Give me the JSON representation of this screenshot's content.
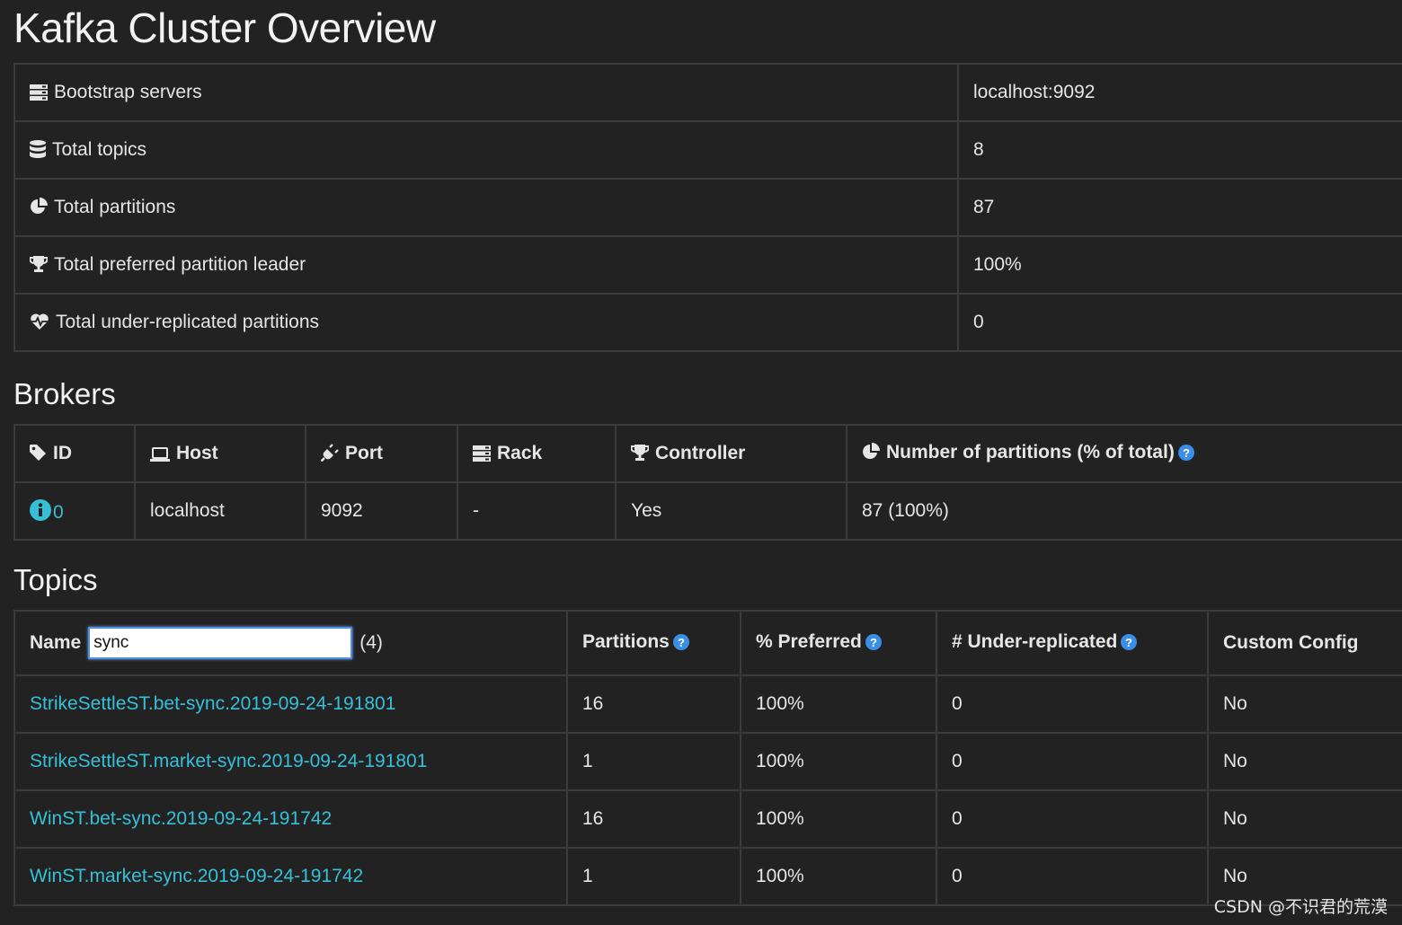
{
  "page": {
    "title": "Kafka Cluster Overview"
  },
  "overview": {
    "rows": [
      {
        "icon": "server-icon",
        "label": "Bootstrap servers",
        "value": "localhost:9092"
      },
      {
        "icon": "database-icon",
        "label": "Total topics",
        "value": "8"
      },
      {
        "icon": "pie-chart-icon",
        "label": "Total partitions",
        "value": "87"
      },
      {
        "icon": "trophy-icon",
        "label": "Total preferred partition leader",
        "value": "100%"
      },
      {
        "icon": "heartbeat-icon",
        "label": "Total under-replicated partitions",
        "value": "0"
      }
    ]
  },
  "brokers": {
    "heading": "Brokers",
    "columns": [
      {
        "icon": "tag-icon",
        "label": "ID"
      },
      {
        "icon": "laptop-icon",
        "label": "Host"
      },
      {
        "icon": "plug-icon",
        "label": "Port"
      },
      {
        "icon": "server-icon",
        "label": "Rack"
      },
      {
        "icon": "trophy-icon",
        "label": "Controller"
      },
      {
        "icon": "pie-chart-icon",
        "label": "Number of partitions (% of total)",
        "help": true
      }
    ],
    "rows": [
      {
        "id": "0",
        "host": "localhost",
        "port": "9092",
        "rack": "-",
        "controller": "Yes",
        "partitions": "87 (100%)"
      }
    ]
  },
  "topics": {
    "heading": "Topics",
    "filter": {
      "label": "Name",
      "value": "sync",
      "count": "(4)"
    },
    "columns": [
      {
        "label": "Partitions",
        "help": true
      },
      {
        "label": "% Preferred",
        "help": true
      },
      {
        "label": "# Under-replicated",
        "help": true
      },
      {
        "label": "Custom Config",
        "help": false
      }
    ],
    "rows": [
      {
        "name": "StrikeSettleST.bet-sync.2019-09-24-191801",
        "partitions": "16",
        "preferred": "100%",
        "under_replicated": "0",
        "custom_config": "No"
      },
      {
        "name": "StrikeSettleST.market-sync.2019-09-24-191801",
        "partitions": "1",
        "preferred": "100%",
        "under_replicated": "0",
        "custom_config": "No"
      },
      {
        "name": "WinST.bet-sync.2019-09-24-191742",
        "partitions": "16",
        "preferred": "100%",
        "under_replicated": "0",
        "custom_config": "No"
      },
      {
        "name": "WinST.market-sync.2019-09-24-191742",
        "partitions": "1",
        "preferred": "100%",
        "under_replicated": "0",
        "custom_config": "No"
      }
    ]
  },
  "watermark": "CSDN @不识君的荒漠",
  "colors": {
    "background": "#222222",
    "link": "#35c0d8",
    "help_icon": "#3a8ee6",
    "border": "#3b3b3b"
  }
}
